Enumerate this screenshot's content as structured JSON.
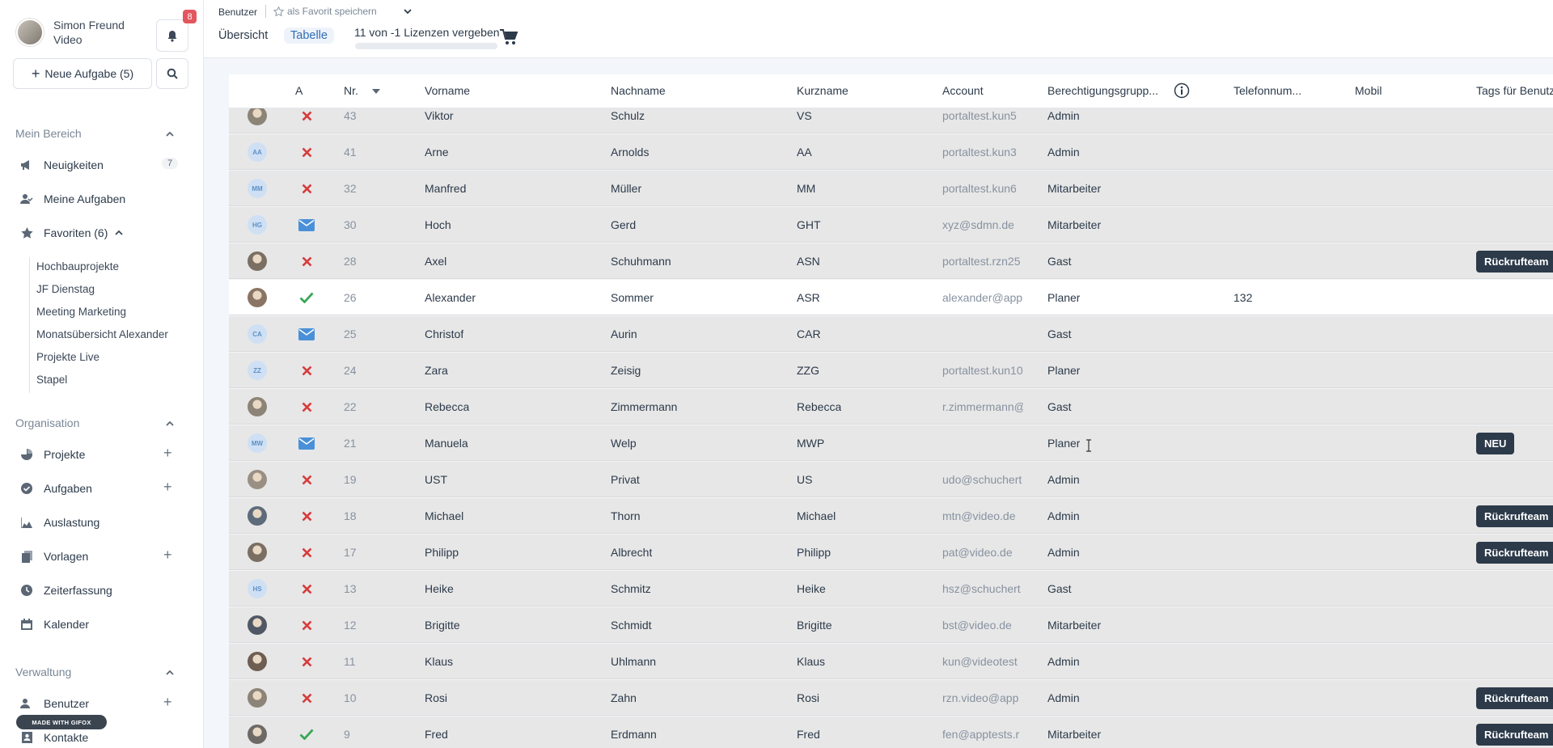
{
  "user": {
    "name": "Simon Freund",
    "company": "Video",
    "notifications": "8"
  },
  "sidebar": {
    "new_task": "Neue Aufgabe (5)",
    "mein_bereich": "Mein Bereich",
    "news": "Neuigkeiten",
    "news_count": "7",
    "my_tasks": "Meine Aufgaben",
    "favorites": "Favoriten (6)",
    "fav_items": [
      "Hochbauprojekte",
      "JF Dienstag",
      "Meeting Marketing",
      "Monatsübersicht Alexander",
      "Projekte Live",
      "Stapel"
    ],
    "organisation": "Organisation",
    "projects": "Projekte",
    "tasks": "Aufgaben",
    "utilization": "Auslastung",
    "templates": "Vorlagen",
    "time_tracking": "Zeiterfassung",
    "calendar": "Kalender",
    "verwaltung": "Verwaltung",
    "users": "Benutzer",
    "contacts": "Kontakte",
    "gif_badge": "MADE WITH GIFOX"
  },
  "topbar": {
    "breadcrumb": "Benutzer",
    "fav_save": "als Favorit speichern",
    "tab_overview": "Übersicht",
    "tab_table": "Tabelle",
    "licenses": "11 von -1 Lizenzen vergeben"
  },
  "table": {
    "headers": {
      "a": "A",
      "nr": "Nr.",
      "vorname": "Vorname",
      "nachname": "Nachname",
      "kurzname": "Kurzname",
      "account": "Account",
      "gruppe": "Berechtigungsgrupp...",
      "telefon": "Telefonnum...",
      "mobil": "Mobil",
      "tags": "Tags für Benutzer"
    },
    "rows": [
      {
        "av": "photo",
        "status": "x",
        "nr": "43",
        "vorname": "Viktor",
        "nachname": "Schulz",
        "kurz": "VS",
        "account": "portaltest.kun5",
        "gruppe": "Admin",
        "tel": "",
        "tag": ""
      },
      {
        "av": "AA",
        "status": "x",
        "nr": "41",
        "vorname": "Arne",
        "nachname": "Arnolds",
        "kurz": "AA",
        "account": "portaltest.kun3",
        "gruppe": "Admin",
        "tel": "",
        "tag": ""
      },
      {
        "av": "MM",
        "status": "x",
        "nr": "32",
        "vorname": "Manfred",
        "nachname": "Müller",
        "kurz": "MM",
        "account": "portaltest.kun6",
        "gruppe": "Mitarbeiter",
        "tel": "",
        "tag": ""
      },
      {
        "av": "HG",
        "status": "mail",
        "nr": "30",
        "vorname": "Hoch",
        "nachname": "Gerd",
        "kurz": "GHT",
        "account": "xyz@sdmn.de",
        "gruppe": "Mitarbeiter",
        "tel": "",
        "tag": ""
      },
      {
        "av": "photo",
        "status": "x",
        "nr": "28",
        "vorname": "Axel",
        "nachname": "Schuhmann",
        "kurz": "ASN",
        "account": "portaltest.rzn25",
        "gruppe": "Gast",
        "tel": "",
        "tag": "Rückrufteam"
      },
      {
        "av": "photo",
        "status": "check",
        "nr": "26",
        "vorname": "Alexander",
        "nachname": "Sommer",
        "kurz": "ASR",
        "account": "alexander@app",
        "gruppe": "Planer",
        "tel": "132",
        "tag": "",
        "light": true
      },
      {
        "av": "CA",
        "status": "mail",
        "nr": "25",
        "vorname": "Christof",
        "nachname": "Aurin",
        "kurz": "CAR",
        "account": "",
        "gruppe": "Gast",
        "tel": "",
        "tag": ""
      },
      {
        "av": "ZZ",
        "status": "x",
        "nr": "24",
        "vorname": "Zara",
        "nachname": "Zeisig",
        "kurz": "ZZG",
        "account": "portaltest.kun10",
        "gruppe": "Planer",
        "tel": "",
        "tag": ""
      },
      {
        "av": "photo",
        "status": "x",
        "nr": "22",
        "vorname": "Rebecca",
        "nachname": "Zimmermann",
        "kurz": "Rebecca",
        "account": "r.zimmermann@",
        "gruppe": "Gast",
        "tel": "",
        "tag": ""
      },
      {
        "av": "MW",
        "status": "mail",
        "nr": "21",
        "vorname": "Manuela",
        "nachname": "Welp",
        "kurz": "MWP",
        "account": "",
        "gruppe": "Planer",
        "tel": "",
        "tag": "NEU"
      },
      {
        "av": "photo",
        "status": "x",
        "nr": "19",
        "vorname": "UST",
        "nachname": "Privat",
        "kurz": "US",
        "account": "udo@schuchert",
        "gruppe": "Admin",
        "tel": "",
        "tag": ""
      },
      {
        "av": "photo",
        "status": "x",
        "nr": "18",
        "vorname": "Michael",
        "nachname": "Thorn",
        "kurz": "Michael",
        "account": "mtn@video.de",
        "gruppe": "Admin",
        "tel": "",
        "tag": "Rückrufteam"
      },
      {
        "av": "photo",
        "status": "x",
        "nr": "17",
        "vorname": "Philipp",
        "nachname": "Albrecht",
        "kurz": "Philipp",
        "account": "pat@video.de",
        "gruppe": "Admin",
        "tel": "",
        "tag": "Rückrufteam"
      },
      {
        "av": "HS",
        "status": "x",
        "nr": "13",
        "vorname": "Heike",
        "nachname": "Schmitz",
        "kurz": "Heike",
        "account": "hsz@schuchert",
        "gruppe": "Gast",
        "tel": "",
        "tag": ""
      },
      {
        "av": "photo",
        "status": "x",
        "nr": "12",
        "vorname": "Brigitte",
        "nachname": "Schmidt",
        "kurz": "Brigitte",
        "account": "bst@video.de",
        "gruppe": "Mitarbeiter",
        "tel": "",
        "tag": ""
      },
      {
        "av": "photo",
        "status": "x",
        "nr": "11",
        "vorname": "Klaus",
        "nachname": "Uhlmann",
        "kurz": "Klaus",
        "account": "kun@videotest",
        "gruppe": "Admin",
        "tel": "",
        "tag": ""
      },
      {
        "av": "photo",
        "status": "x",
        "nr": "10",
        "vorname": "Rosi",
        "nachname": "Zahn",
        "kurz": "Rosi",
        "account": "rzn.video@app",
        "gruppe": "Admin",
        "tel": "",
        "tag": "Rückrufteam"
      },
      {
        "av": "photo",
        "status": "check",
        "nr": "9",
        "vorname": "Fred",
        "nachname": "Erdmann",
        "kurz": "Fred",
        "account": "fen@apptests.r",
        "gruppe": "Mitarbeiter",
        "tel": "",
        "tag": "Rückrufteam"
      }
    ]
  },
  "colors": {
    "accent": "#2f6db3",
    "danger": "#d63b3b",
    "success": "#3aa757",
    "mail": "#4a90d9",
    "tag_bg": "#2c3a4a"
  }
}
